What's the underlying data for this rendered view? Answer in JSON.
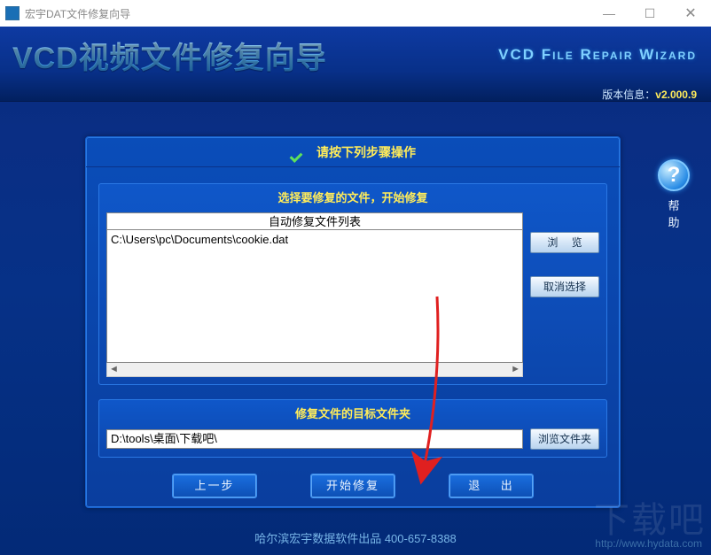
{
  "window": {
    "title": "宏宇DAT文件修复向导",
    "minimize": "—",
    "maximize": "☐",
    "close": "✕"
  },
  "banner": {
    "title_cn": "VCD视频文件修复向导",
    "title_en": "VCD File Repair Wizard",
    "version_label": "版本信息：",
    "version_value": "v2.000.9"
  },
  "panel": {
    "header": "请按下列步骤操作"
  },
  "select": {
    "title": "选择要修复的文件，开始修复",
    "list_header": "自动修复文件列表",
    "items": [
      "C:\\Users\\pc\\Documents\\cookie.dat"
    ],
    "browse": "浏 览",
    "cancel_select": "取消选择"
  },
  "target": {
    "title": "修复文件的目标文件夹",
    "path": "D:\\tools\\桌面\\下载吧\\",
    "browse_folder": "浏览文件夹"
  },
  "actions": {
    "back": "上一步",
    "start": "开始修复",
    "exit": "退 出"
  },
  "help": {
    "symbol": "?",
    "label": "帮 助"
  },
  "footer": {
    "text": "哈尔滨宏宇数据软件出品  400-657-8388",
    "url": "http://www.hydata.com"
  },
  "watermark": "下载吧"
}
